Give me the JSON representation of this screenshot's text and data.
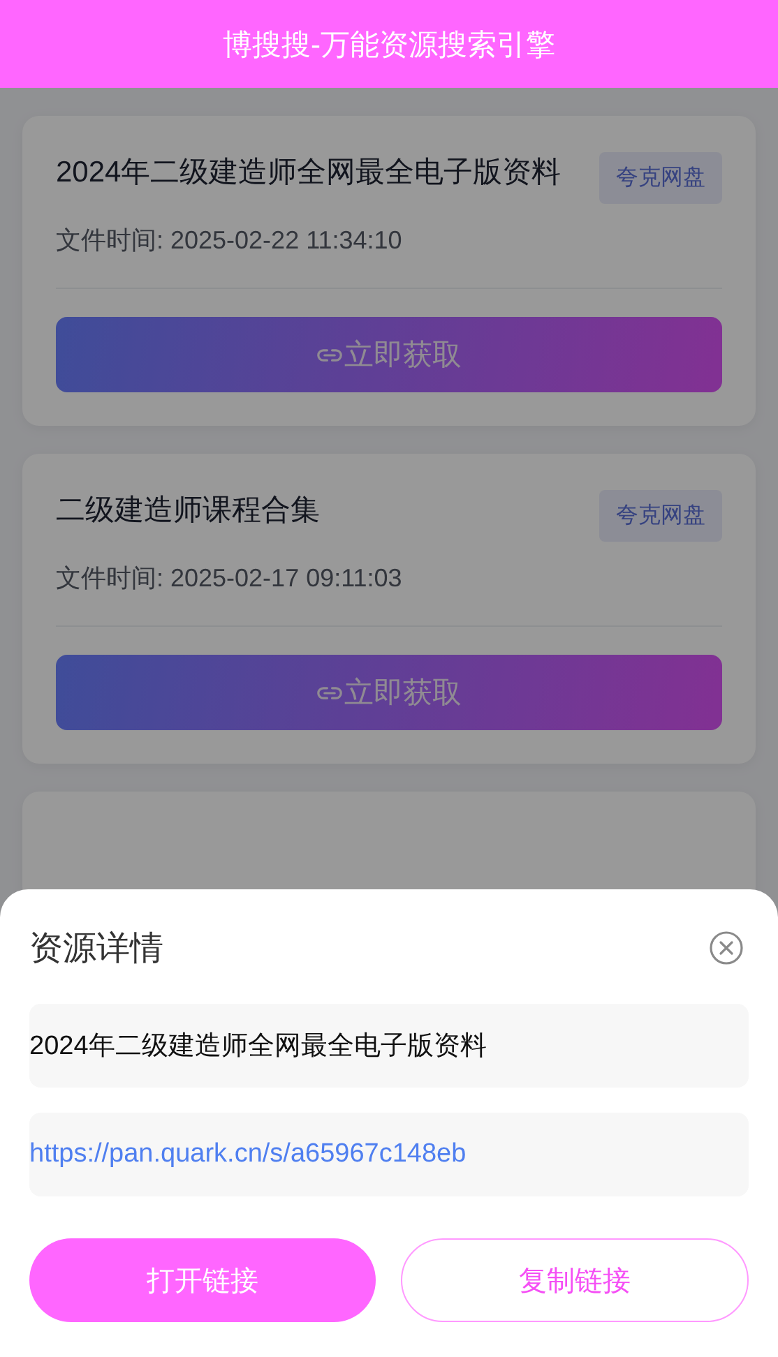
{
  "header": {
    "title": "博搜搜-万能资源搜索引擎"
  },
  "cards": [
    {
      "title": "2024年二级建造师全网最全电子版资料",
      "source_tag": "夸克网盘",
      "file_time": "文件时间: 2025-02-22 11:34:10",
      "action_label": "立即获取"
    },
    {
      "title": "二级建造师课程合集",
      "source_tag": "夸克网盘",
      "file_time": "文件时间: 2025-02-17 09:11:03",
      "action_label": "立即获取"
    }
  ],
  "sheet": {
    "title": "资源详情",
    "resource_name": "2024年二级建造师全网最全电子版资料",
    "link": "https://pan.quark.cn/s/a65967c148eb",
    "buttons": [
      {
        "label": "打开链接",
        "kind": "primary"
      },
      {
        "label": "复制链接",
        "kind": "outline"
      }
    ]
  }
}
